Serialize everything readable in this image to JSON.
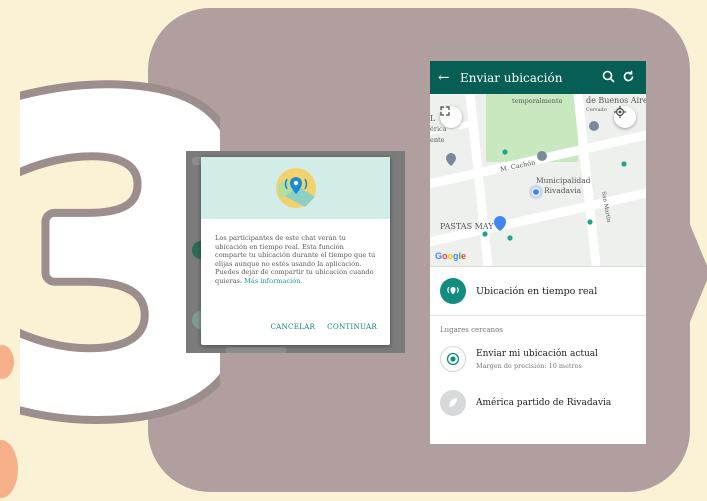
{
  "colors": {
    "background": "#fbf2d6",
    "card": "#b19f9f",
    "whatsapp_dark": "#075e54",
    "whatsapp_teal": "#128c7e",
    "accent_blob": "#f6b08a"
  },
  "step_number": "3",
  "dialog": {
    "text": "Los participantes de este chat verán tu ubicación en tiempo real. Esta función comparte tu ubicación durante el tiempo que tú elijas aunque no estés usando la aplicación. Puedes dejar de compartir tu ubicación cuando quieras.",
    "link": "Más información.",
    "cancel_label": "CANCELAR",
    "continue_label": "CONTINUAR",
    "icon": "live-location-icon"
  },
  "phone": {
    "title": "Enviar ubicación",
    "icons": [
      "back-arrow-icon",
      "search-icon",
      "refresh-icon"
    ],
    "map_labels": {
      "temporal": "temporalmente",
      "buenos_aires": "de Buenos Aires",
      "cerrado": "Cerrado",
      "cachon": "M. Cachón",
      "municipalidad": "Municipalidad",
      "rivadavia": "Rivadavia",
      "san_martin": "San Martín",
      "pastas": "PASTAS MAY",
      "left_a": "L",
      "left_b": "érica",
      "left_c": "ente",
      "google": "Google"
    },
    "live_label": "Ubicación en tiempo real",
    "section_label": "Lugares cercanos",
    "current_location_label": "Enviar mi ubicación actual",
    "current_location_sub": "Margen de precisión: 10 metros",
    "place_label": "América partido de Rivadavia"
  }
}
